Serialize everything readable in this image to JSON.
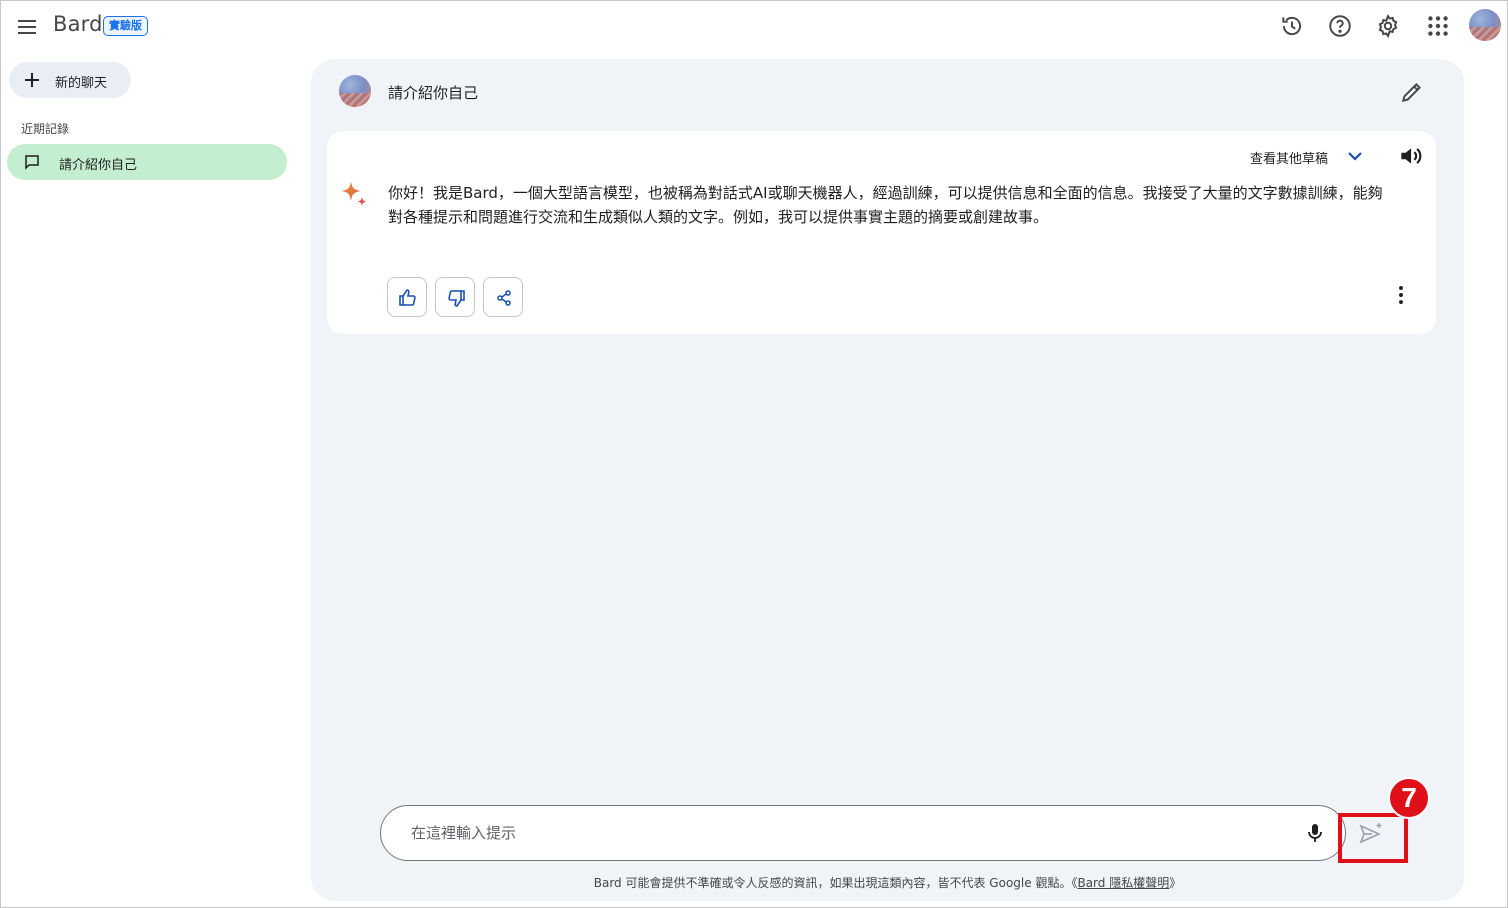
{
  "header": {
    "brand": "Bard",
    "badge": "實驗版",
    "icons": [
      "menu-icon",
      "history-icon",
      "help-icon",
      "settings-icon",
      "apps-icon",
      "account-avatar"
    ]
  },
  "sidebar": {
    "new_chat_label": "新的聊天",
    "recent_title": "近期記錄",
    "recent_items": [
      {
        "label": "請介紹你自己",
        "active": true
      }
    ]
  },
  "conversation": {
    "prompt": "請介紹你自己",
    "view_drafts": "查看其他草稿",
    "response": "你好！我是Bard，一個大型語言模型，也被稱為對話式AI或聊天機器人，經過訓練，可以提供信息和全面的信息。我接受了大量的文字數據訓練，能夠對各種提示和問題進行交流和生成類似人類的文字。例如，我可以提供事實主題的摘要或創建故事。"
  },
  "input": {
    "placeholder": "在這裡輸入提示",
    "value": ""
  },
  "footer": {
    "disclaimer": "Bard 可能會提供不準確或令人反感的資訊，如果出現這類內容，皆不代表 Google 觀點。",
    "privacy_link": "Bard 隱私權聲明",
    "link_open": "《",
    "link_close": "》"
  },
  "annotation": {
    "step_number": "7"
  },
  "colors": {
    "accent": "#1a73e8",
    "active_item": "#c4eed0",
    "panel_bg": "#f0f4f9",
    "highlight": "#e0101b"
  }
}
